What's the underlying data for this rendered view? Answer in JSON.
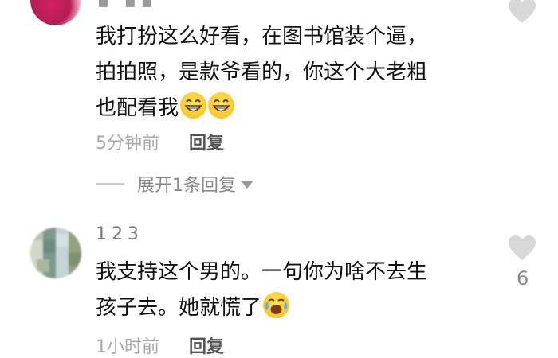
{
  "comments": [
    {
      "text_line1": "我打扮这么好看，在图书馆装个逼，",
      "text_line2": "拍拍照，是款爷看的，你这个大老粗",
      "text_line3": "也配看我",
      "emoji": "grin-emoji",
      "time": "5分钟前",
      "reply_label": "回复",
      "expand_label": "展开1条回复"
    },
    {
      "username": "123",
      "text_line1": "我支持这个男的。一句你为啥不去生",
      "text_line2": "孩子去。她就慌了",
      "emoji": "tears-of-joy-emoji",
      "time": "1小时前",
      "reply_label": "回复",
      "like_count": "6"
    }
  ],
  "icons": {
    "like": "heart-icon",
    "expand": "caret-down-icon"
  },
  "colors": {
    "text": "#111111",
    "meta": "#a8a8a8",
    "heart": "#d8d8d8",
    "emoji": "#ffc62a"
  }
}
